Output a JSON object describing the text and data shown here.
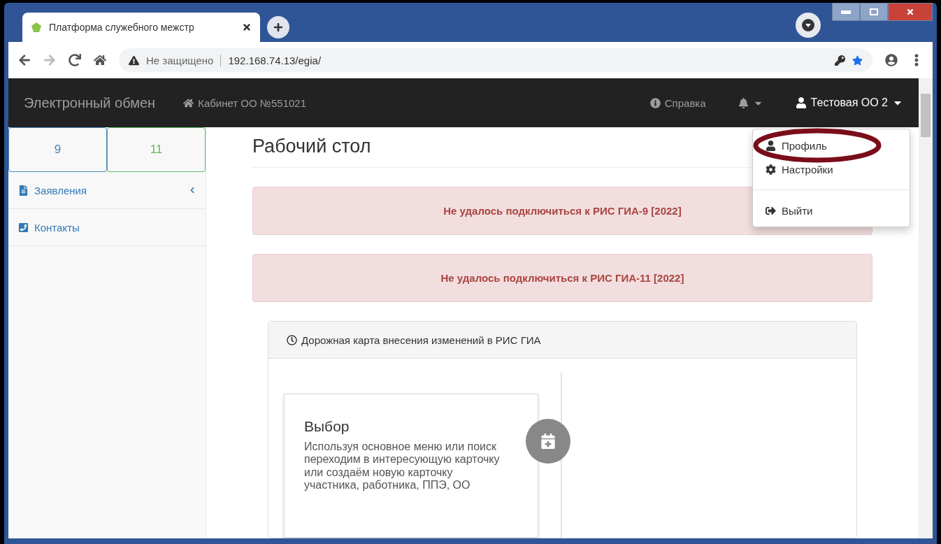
{
  "browser": {
    "tab_title": "Платформа служебного межстр",
    "security": "Не защищено",
    "url": "192.168.74.13/egia/"
  },
  "navbar": {
    "brand": "Электронный обмен",
    "cabinet": "Кабинет ОО №551021",
    "help": "Справка",
    "user": "Тестовая ОО 2"
  },
  "user_menu": {
    "items": [
      {
        "kind": "profile",
        "label": "Профиль",
        "highlighted": true
      },
      {
        "kind": "settings",
        "label": "Настройки",
        "highlighted": false
      },
      {
        "kind": "logout",
        "label": "Выйти",
        "highlighted": false
      }
    ]
  },
  "sidebar": {
    "grade_tabs": [
      {
        "label": "9",
        "color": "#4a86b8"
      },
      {
        "label": "11",
        "color": "#5cb85c"
      }
    ],
    "items": [
      {
        "kind": "file",
        "label": "Заявления",
        "expandable": true
      },
      {
        "kind": "phone",
        "label": "Контакты",
        "expandable": false
      }
    ]
  },
  "page": {
    "title": "Рабочий стол",
    "alerts": [
      "Не удалось подключиться к РИС ГИА-9 [2022]",
      "Не удалось подключиться к РИС ГИА-11 [2022]"
    ],
    "roadmap": {
      "title": "Дорожная карта внесения изменений в РИС ГИА",
      "step": {
        "title": "Выбор",
        "text": "Используя основное меню или поиск переходим в интересующую карточку или создаём новую карточку участника, работника, ППЭ, ОО"
      }
    }
  }
}
